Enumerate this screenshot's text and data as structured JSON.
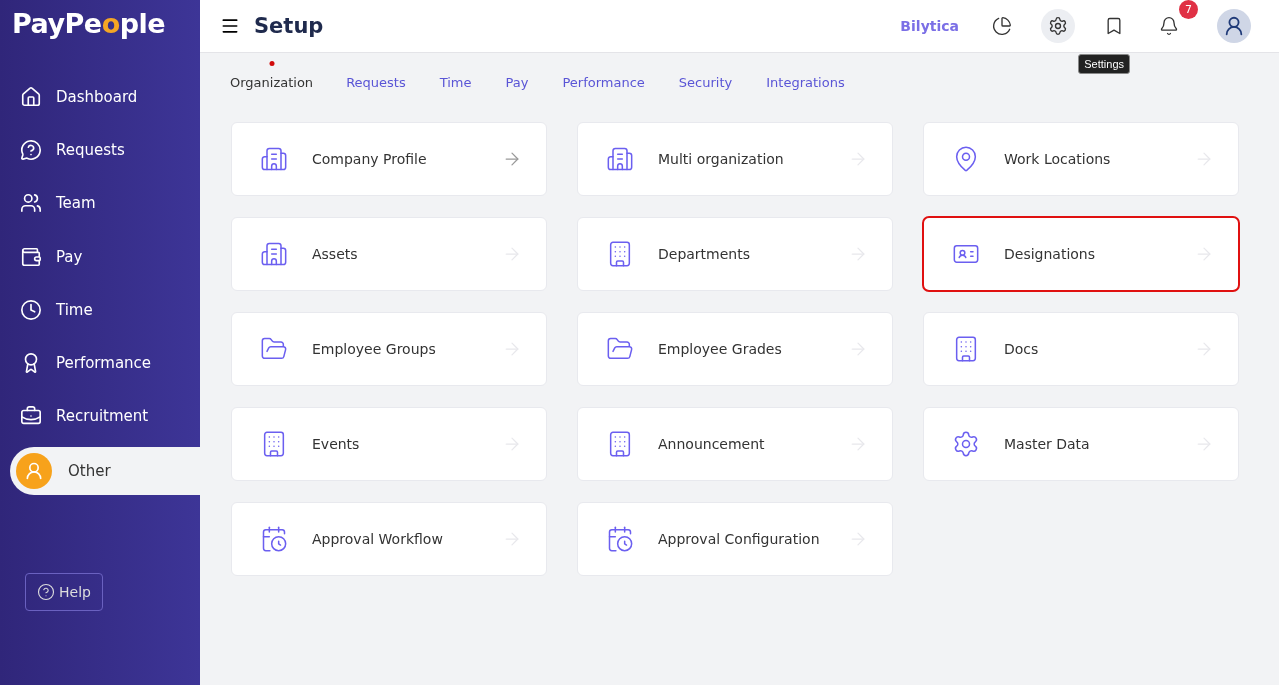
{
  "logo": {
    "parts": [
      "PayPe",
      "o",
      "ple"
    ]
  },
  "sidebar": {
    "items": [
      {
        "label": "Dashboard",
        "selected": false
      },
      {
        "label": "Requests",
        "selected": false
      },
      {
        "label": "Team",
        "selected": false
      },
      {
        "label": "Pay",
        "selected": false
      },
      {
        "label": "Time",
        "selected": false
      },
      {
        "label": "Performance",
        "selected": false
      },
      {
        "label": "Recruitment",
        "selected": false
      },
      {
        "label": "Other",
        "selected": true
      }
    ],
    "help": "Help"
  },
  "header": {
    "title": "Setup",
    "brand": "Bilytica",
    "notification_count": "7",
    "tooltip": "Settings"
  },
  "tabs": [
    {
      "label": "Organization",
      "selected": true
    },
    {
      "label": "Requests",
      "selected": false
    },
    {
      "label": "Time",
      "selected": false
    },
    {
      "label": "Pay",
      "selected": false
    },
    {
      "label": "Performance",
      "selected": false
    },
    {
      "label": "Security",
      "selected": false
    },
    {
      "label": "Integrations",
      "selected": false
    }
  ],
  "cards": [
    {
      "label": "Company Profile",
      "hovered": true,
      "highlighted": false
    },
    {
      "label": "Multi organization",
      "hovered": false,
      "highlighted": false
    },
    {
      "label": "Work Locations",
      "hovered": false,
      "highlighted": false
    },
    {
      "label": "Assets",
      "hovered": false,
      "highlighted": false
    },
    {
      "label": "Departments",
      "hovered": false,
      "highlighted": false
    },
    {
      "label": "Designations",
      "hovered": false,
      "highlighted": true
    },
    {
      "label": "Employee Groups",
      "hovered": false,
      "highlighted": false
    },
    {
      "label": "Employee Grades",
      "hovered": false,
      "highlighted": false
    },
    {
      "label": "Docs",
      "hovered": false,
      "highlighted": false
    },
    {
      "label": "Events",
      "hovered": false,
      "highlighted": false
    },
    {
      "label": "Announcement",
      "hovered": false,
      "highlighted": false
    },
    {
      "label": "Master Data",
      "hovered": false,
      "highlighted": false
    },
    {
      "label": "Approval Workflow",
      "hovered": false,
      "highlighted": false
    },
    {
      "label": "Approval Configuration",
      "hovered": false,
      "highlighted": false
    }
  ]
}
